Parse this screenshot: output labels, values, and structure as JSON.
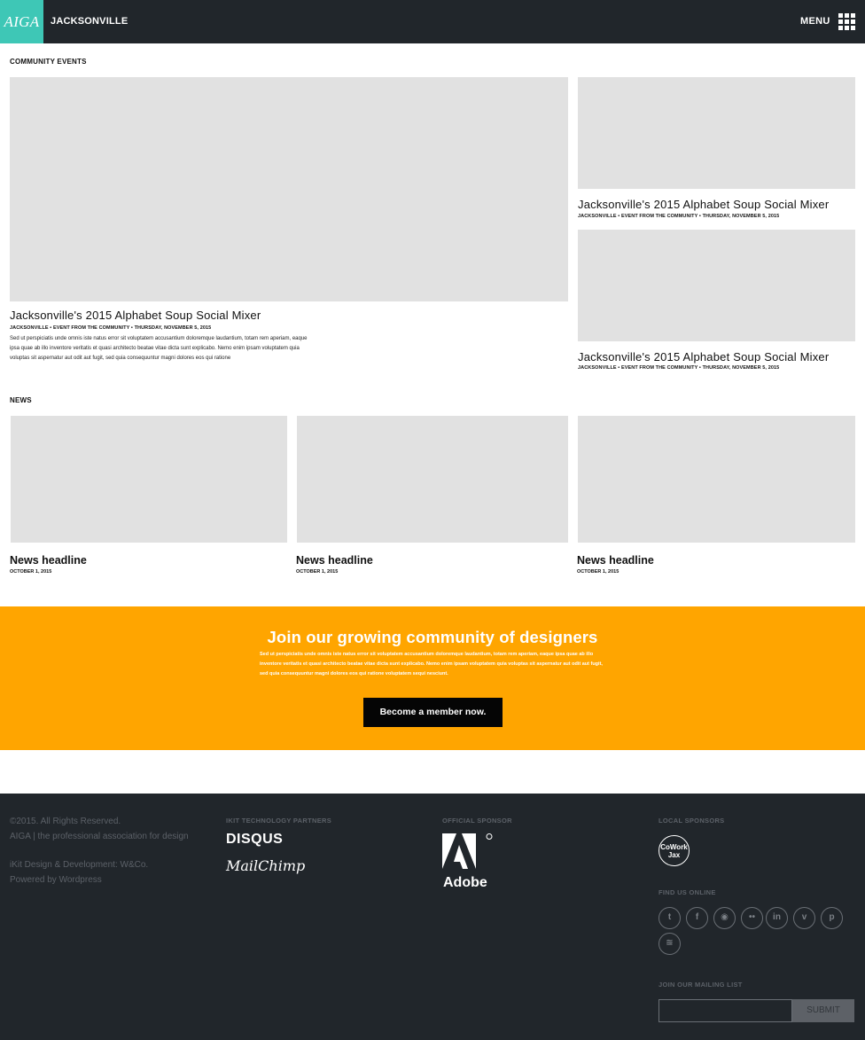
{
  "header": {
    "logo": "AIGA",
    "chapter": "JACKSONVILLE",
    "menu_label": "MENU"
  },
  "community_events": {
    "label": "COMMUNITY EVENTS",
    "featured": {
      "title": "Jacksonville's 2015 Alphabet Soup Social Mixer",
      "meta": "JACKSONVILLE • EVENT FROM THE COMMUNITY • THURSDAY, NOVEMBER 5, 2015",
      "body": "Sed ut perspiciatis unde omnis iste natus error sit voluptatem accusantium doloremque laudantium, totam rem aperiam, eaque ipsa quae ab illo inventore veritatis et quasi architecto beatae vitae dicta sunt explicabo. Nemo enim ipsam voluptatem quia voluptas sit aspernatur aut odit aut fugit, sed quia consequuntur magni dolores eos qui ratione"
    },
    "side": [
      {
        "title": "Jacksonville's 2015 Alphabet Soup Social Mixer",
        "meta": "JACKSONVILLE • EVENT FROM THE COMMUNITY • THURSDAY, NOVEMBER 5, 2015"
      },
      {
        "title": "Jacksonville's 2015 Alphabet Soup Social Mixer",
        "meta": "JACKSONVILLE • EVENT FROM THE COMMUNITY • THURSDAY, NOVEMBER 5, 2015"
      }
    ]
  },
  "news": {
    "label": "NEWS",
    "items": [
      {
        "headline": "News headline",
        "date": "OCTOBER 1, 2015"
      },
      {
        "headline": "News headline",
        "date": "OCTOBER 1, 2015"
      },
      {
        "headline": "News headline",
        "date": "OCTOBER 1, 2015"
      }
    ]
  },
  "cta": {
    "title": "Join our growing community of designers",
    "body": "Sed ut perspiciatis unde omnis iste natus error sit voluptatem accusantium doloremque laudantium, totam rem aperiam, eaque ipsa quae ab illo inventore veritatis et quasi architecto beatae vitae dicta sunt explicabo. Nemo enim ipsam voluptatem quia voluptas sit aspernatur aut odit aut fugit, sed quia consequuntur magni dolores eos qui ratione voluptatem sequi nesciunt.",
    "button": "Become a member now.",
    "color": "#ffa500"
  },
  "footer": {
    "copyright": "©2015. All Rights Reserved.",
    "tagline": "AIGA  |  the professional association for design",
    "credit": "iKit Design & Development: W&Co.",
    "powered": "Powered by Wordpress",
    "partners_heading": "IKIT TECHNOLOGY PARTNERS",
    "partner_1": "DISQUS",
    "partner_2": "MailChimp",
    "sponsor_heading": "OFFICIAL SPONSOR",
    "sponsor": "Adobe",
    "local_heading": "LOCAL SPONSORS",
    "local_sponsor_line1": "CoWork",
    "local_sponsor_line2": "Jax",
    "find_heading": "FIND US ONLINE",
    "social": [
      "twitter-icon",
      "facebook-icon",
      "instagram-icon",
      "flickr-icon",
      "linkedin-icon",
      "vimeo-icon",
      "pinterest-icon",
      "rss-icon"
    ],
    "mailing_heading": "JOIN OUR MAILING LIST",
    "submit": "SUBMIT"
  },
  "colors": {
    "brand_teal": "#3ec7b6",
    "dark": "#21262b",
    "placeholder": "#e1e1e1"
  }
}
